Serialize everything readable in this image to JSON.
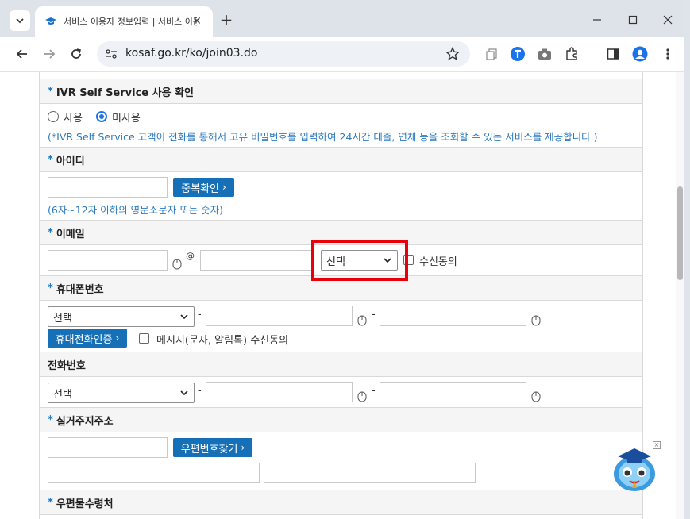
{
  "browser": {
    "tab_title": "서비스 이용자 정보입력 | 서비스 이용",
    "url": "kosaf.go.kr/ko/join03.do"
  },
  "form": {
    "ivr": {
      "label": "IVR Self Service 사용 확인",
      "option_use": "사용",
      "option_nouse": "미사용",
      "selected": "미사용",
      "hint": "(*IVR Self Service 고객이 전화를 통해서 고유 비밀번호를 입력하여 24시간 대출, 연체 등을 조회할 수 있는 서비스를 제공합니다.)"
    },
    "id": {
      "label": "아이디",
      "dup_button": "중복확인",
      "hint": "(6자~12자 이하의 영문소문자 또는 숫자)"
    },
    "email": {
      "label": "이메일",
      "at": "@",
      "domain_select": "선택",
      "consent": "수신동의"
    },
    "mobile": {
      "label": "휴대폰번호",
      "prefix_select": "선택",
      "dash": "-",
      "verify_button": "휴대전화인증",
      "consent": "메시지(문자, 알림톡) 수신동의"
    },
    "phone": {
      "label": "전화번호",
      "prefix_select": "선택",
      "dash": "-"
    },
    "address": {
      "label": "실거주지주소",
      "zip_button": "우편번호찾기"
    },
    "mail_addr": {
      "label": "우편물수령처"
    },
    "required_mark": "*"
  },
  "colors": {
    "accent_blue": "#1570b8",
    "hint_blue": "#2c7bbf",
    "highlight": "#e8000b"
  }
}
